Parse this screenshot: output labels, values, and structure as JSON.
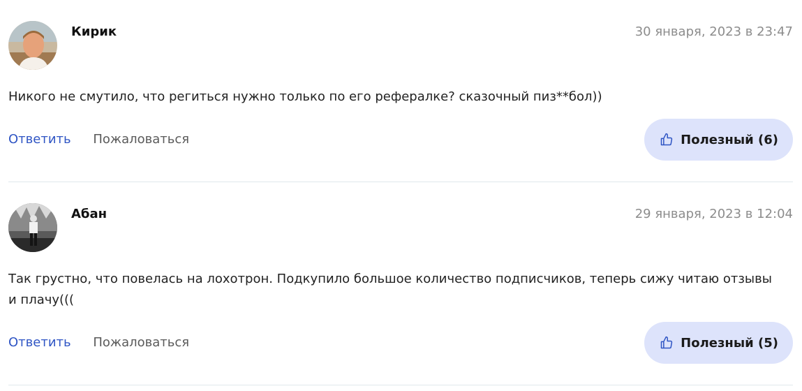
{
  "comments": [
    {
      "author": "Кирик",
      "date": "30 января, 2023 в 23:47",
      "text": "Никого не смутило, что региться нужно только по его рефералке? сказочный пиз**бол))",
      "reply_label": "Ответить",
      "complain_label": "Пожаловаться",
      "useful_label": "Полезный (6)",
      "avatar_icon": "avatar-photo"
    },
    {
      "author": "Абан",
      "date": "29 января, 2023 в 12:04",
      "text": "Так грустно, что повелась на лохотрон. Подкупило большое количество подписчиков, теперь сижу читаю отзывы и плачу(((",
      "reply_label": "Ответить",
      "complain_label": "Пожаловаться",
      "useful_label": "Полезный (5)",
      "avatar_icon": "avatar-photo"
    }
  ],
  "colors": {
    "link": "#2f55c4",
    "useful_bg": "#dde3fb",
    "date": "#8c8c8c"
  },
  "icons": {
    "useful": "thumbs-up-icon"
  }
}
